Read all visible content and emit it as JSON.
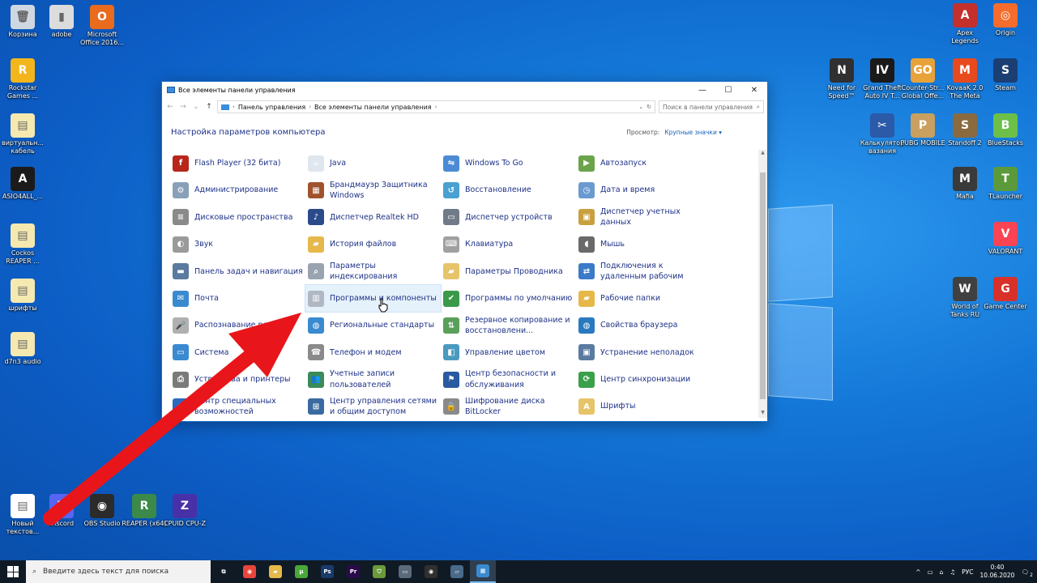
{
  "desktop": {
    "left_icons": [
      {
        "label": "Корзина",
        "color": "#cfd8e0",
        "glyph": "🗑"
      },
      {
        "label": "adobe",
        "color": "#dcdcdc",
        "glyph": "▮"
      },
      {
        "label": "Microsoft Office 2016...",
        "color": "#e86b1e",
        "glyph": "O"
      },
      {
        "label": "Rockstar Games ...",
        "color": "#f2b51b",
        "glyph": "R"
      },
      {
        "label": "виртуальн... кабель",
        "color": "#f5e9b0",
        "glyph": "▤"
      },
      {
        "label": "ASIO4ALL_...",
        "color": "#1b1b1b",
        "glyph": "A"
      },
      {
        "label": "Cockos REAPER ...",
        "color": "#f5e9b0",
        "glyph": "▤"
      },
      {
        "label": "шрифты",
        "color": "#f5e9b0",
        "glyph": "▤"
      },
      {
        "label": "d7n3 audio",
        "color": "#f5e9b0",
        "glyph": "▤"
      }
    ],
    "bottom_icons": [
      {
        "label": "Новый текстов...",
        "color": "#ffffff",
        "glyph": "▤"
      },
      {
        "label": "Discord",
        "color": "#5865f2",
        "glyph": "D"
      },
      {
        "label": "OBS Studio",
        "color": "#2b2b2b",
        "glyph": "◉"
      },
      {
        "label": "REAPER (x64)",
        "color": "#3b8a4a",
        "glyph": "R"
      },
      {
        "label": "CPUID CPU-Z",
        "color": "#4830a8",
        "glyph": "Z"
      }
    ],
    "right_icons": [
      {
        "label": "Apex Legends",
        "color": "#c4302b",
        "glyph": "A"
      },
      {
        "label": "Origin",
        "color": "#f56c2d",
        "glyph": "◎"
      },
      {
        "label": "Need for Speed™",
        "color": "#303030",
        "glyph": "N"
      },
      {
        "label": "Grand Theft Auto IV T...",
        "color": "#1a1a1a",
        "glyph": "IV"
      },
      {
        "label": "Counter-Str... Global Offe...",
        "color": "#e8a23a",
        "glyph": "GO"
      },
      {
        "label": "KovaaK 2.0 The Meta",
        "color": "#e84a1e",
        "glyph": "M"
      },
      {
        "label": "Steam",
        "color": "#1b3f73",
        "glyph": "S"
      },
      {
        "label": "Калькулятор вазания",
        "color": "#2a5aa8",
        "glyph": "✂"
      },
      {
        "label": "PUBG MOBILE",
        "color": "#c9a060",
        "glyph": "P"
      },
      {
        "label": "Standoff 2",
        "color": "#8a6b40",
        "glyph": "S"
      },
      {
        "label": "BlueStacks",
        "color": "#6cc04a",
        "glyph": "B"
      },
      {
        "label": "Mafia",
        "color": "#3a3a3a",
        "glyph": "M"
      },
      {
        "label": "TLauncher",
        "color": "#5a9a3a",
        "glyph": "T"
      },
      {
        "label": "VALORANT",
        "color": "#fa4454",
        "glyph": "V"
      },
      {
        "label": "World of Tanks RU",
        "color": "#404040",
        "glyph": "W"
      },
      {
        "label": "Game Center",
        "color": "#d8312a",
        "glyph": "G"
      }
    ]
  },
  "window": {
    "title": "Все элементы панели управления",
    "minimize": "—",
    "maximize": "☐",
    "close": "✕",
    "back": "←",
    "forward": "→",
    "recent": "⌄",
    "up": "↑",
    "breadcrumb": [
      "Панель управления",
      "Все элементы панели управления"
    ],
    "address_dropdown": "⌄",
    "refresh": "↻",
    "search_placeholder": "Поиск в панели управления",
    "search_glyph": "⌕",
    "header_title": "Настройка параметров компьютера",
    "view_label": "Просмотр:",
    "view_value": "Крупные значки ▾",
    "items": [
      {
        "label": "Flash Player (32 бита)",
        "icon": "flash-icon",
        "color": "#b8261c",
        "glyph": "f"
      },
      {
        "label": "Java",
        "icon": "java-icon",
        "color": "#dfe6ee",
        "glyph": "☕"
      },
      {
        "label": "Windows To Go",
        "icon": "usb-drive-icon",
        "color": "#4b8bd6",
        "glyph": "⇋"
      },
      {
        "label": "Автозапуск",
        "icon": "autoplay-icon",
        "color": "#6aa34a",
        "glyph": "▶"
      },
      {
        "label": "Администрирование",
        "icon": "admin-tools-icon",
        "color": "#8aa0b8",
        "glyph": "⚙"
      },
      {
        "label": "Брандмауэр Защитника Windows",
        "icon": "firewall-icon",
        "color": "#a0522d",
        "glyph": "▦"
      },
      {
        "label": "Восстановление",
        "icon": "recovery-icon",
        "color": "#4aa0d0",
        "glyph": "↺"
      },
      {
        "label": "Дата и время",
        "icon": "calendar-clock-icon",
        "color": "#6a9ad0",
        "glyph": "◷"
      },
      {
        "label": "Дисковые пространства",
        "icon": "storage-spaces-icon",
        "color": "#8a8a8a",
        "glyph": "≡"
      },
      {
        "label": "Диспетчер Realtek HD",
        "icon": "realtek-icon",
        "color": "#2a4a8a",
        "glyph": "♪"
      },
      {
        "label": "Диспетчер устройств",
        "icon": "device-manager-icon",
        "color": "#707a88",
        "glyph": "▭"
      },
      {
        "label": "Диспетчер учетных данных",
        "icon": "credential-icon",
        "color": "#c9a040",
        "glyph": "▣"
      },
      {
        "label": "Звук",
        "icon": "speaker-icon",
        "color": "#9a9a9a",
        "glyph": "◐"
      },
      {
        "label": "История файлов",
        "icon": "file-history-icon",
        "color": "#e6b84a",
        "glyph": "▰"
      },
      {
        "label": "Клавиатура",
        "icon": "keyboard-icon",
        "color": "#a0a0a0",
        "glyph": "⌨"
      },
      {
        "label": "Мышь",
        "icon": "mouse-icon",
        "color": "#6a6a6a",
        "glyph": "◖"
      },
      {
        "label": "Панель задач и навигация",
        "icon": "taskbar-icon",
        "color": "#5a7aa0",
        "glyph": "▬"
      },
      {
        "label": "Параметры индексирования",
        "icon": "indexing-icon",
        "color": "#9aa4b0",
        "glyph": "⌕"
      },
      {
        "label": "Параметры Проводника",
        "icon": "folder-options-icon",
        "color": "#e6c46a",
        "glyph": "▰"
      },
      {
        "label": "Подключения к удаленным рабочим",
        "icon": "remote-desktop-icon",
        "color": "#3a7ac8",
        "glyph": "⇄"
      },
      {
        "label": "Почта",
        "icon": "mail-icon",
        "color": "#3a8ad0",
        "glyph": "✉"
      },
      {
        "label": "Программы и компоненты",
        "icon": "programs-features-icon",
        "color": "#b0b8c4",
        "glyph": "▥"
      },
      {
        "label": "Программы по умолчанию",
        "icon": "default-programs-icon",
        "color": "#3a9a4a",
        "glyph": "✔"
      },
      {
        "label": "Рабочие папки",
        "icon": "work-folders-icon",
        "color": "#e6b84a",
        "glyph": "▰"
      },
      {
        "label": "Распознавание речи",
        "icon": "microphone-icon",
        "color": "#b0b0b0",
        "glyph": "🎤"
      },
      {
        "label": "Региональные стандарты",
        "icon": "globe-icon",
        "color": "#3a8ad0",
        "glyph": "◍"
      },
      {
        "label": "Резервное копирование и восстановлени...",
        "icon": "backup-icon",
        "color": "#5aa05a",
        "glyph": "⇅"
      },
      {
        "label": "Свойства браузера",
        "icon": "internet-options-icon",
        "color": "#2a7ac0",
        "glyph": "◍"
      },
      {
        "label": "Система",
        "icon": "system-icon",
        "color": "#3a8ad0",
        "glyph": "▭"
      },
      {
        "label": "Телефон и модем",
        "icon": "phone-modem-icon",
        "color": "#8a8a8a",
        "glyph": "☎"
      },
      {
        "label": "Управление цветом",
        "icon": "color-management-icon",
        "color": "#4a9ac0",
        "glyph": "◧"
      },
      {
        "label": "Устранение неполадок",
        "icon": "troubleshooting-icon",
        "color": "#5a7aa0",
        "glyph": "▣"
      },
      {
        "label": "Устройства и принтеры",
        "icon": "printer-icon",
        "color": "#7a7a7a",
        "glyph": "⎙"
      },
      {
        "label": "Учетные записи пользователей",
        "icon": "user-accounts-icon",
        "color": "#3a8a5a",
        "glyph": "👥"
      },
      {
        "label": "Центр безопасности и обслуживания",
        "icon": "security-flag-icon",
        "color": "#2a5aa0",
        "glyph": "⚑"
      },
      {
        "label": "Центр синхронизации",
        "icon": "sync-center-icon",
        "color": "#3aa04a",
        "glyph": "⟳"
      },
      {
        "label": "Центр специальных возможностей",
        "icon": "accessibility-icon",
        "color": "#2a6ac0",
        "glyph": "◉"
      },
      {
        "label": "Центр управления сетями и общим доступом",
        "icon": "network-icon",
        "color": "#3a6aa0",
        "glyph": "⊞"
      },
      {
        "label": "Шифрование диска BitLocker",
        "icon": "bitlocker-icon",
        "color": "#8a8a8a",
        "glyph": "🔒"
      },
      {
        "label": "Шрифты",
        "icon": "fonts-icon",
        "color": "#e6c46a",
        "glyph": "A"
      }
    ],
    "hover_index": 21
  },
  "taskbar": {
    "search_placeholder": "Введите здесь текст для поиска",
    "search_glyph": "⌕",
    "apps": [
      {
        "name": "task-view",
        "color": "#101a24",
        "glyph": "⧉"
      },
      {
        "name": "chrome",
        "color": "#e8453c",
        "glyph": "◉"
      },
      {
        "name": "file-explorer",
        "color": "#e6b84a",
        "glyph": "▰"
      },
      {
        "name": "utorrent",
        "color": "#4aa83a",
        "glyph": "µ"
      },
      {
        "name": "photoshop",
        "color": "#1a3a6a",
        "glyph": "Ps"
      },
      {
        "name": "premiere",
        "color": "#2a0a4a",
        "glyph": "Pr"
      },
      {
        "name": "vpn-shield",
        "color": "#6a9a3a",
        "glyph": "⛉"
      },
      {
        "name": "devices",
        "color": "#5a6a7a",
        "glyph": "▭"
      },
      {
        "name": "obs",
        "color": "#303030",
        "glyph": "◉"
      },
      {
        "name": "drive-tool",
        "color": "#4a6a8a",
        "glyph": "▱"
      },
      {
        "name": "control-panel",
        "color": "#3a8ad0",
        "glyph": "▦"
      }
    ],
    "active_index": 10,
    "tray_chevron": "^",
    "language": "РУС",
    "time": "0:40",
    "date": "10.06.2020",
    "notification_count": "2"
  },
  "annotation": {
    "arrow_color": "#e8161a"
  }
}
